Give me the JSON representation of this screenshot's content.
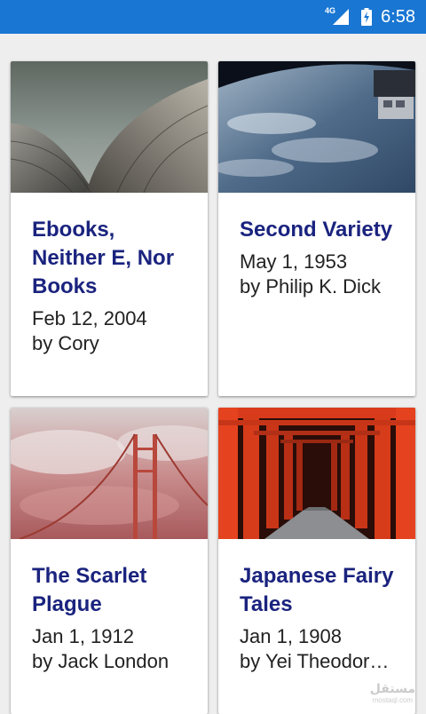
{
  "status_bar": {
    "network_type": "4G",
    "time": "6:58",
    "icons": [
      "signal-icon",
      "battery-charging-icon"
    ]
  },
  "books": [
    {
      "title": "Ebooks, Neither E, Nor Books",
      "date": "Feb 12, 2004",
      "author": "by Cory",
      "cover": "sydney-opera-house-roof-photo"
    },
    {
      "title": "Second Variety",
      "date": "May 1, 1953",
      "author": "by Philip K. Dick",
      "cover": "earth-from-space-station-photo"
    },
    {
      "title": "The Scarlet Plague",
      "date": "Jan 1, 1912",
      "author": "by Jack London",
      "cover": "golden-gate-bridge-fog-photo"
    },
    {
      "title": "Japanese Fairy Tales",
      "date": "Jan 1, 1908",
      "author": "by Yei Theodor…",
      "cover": "torii-gates-path-photo"
    }
  ],
  "colors": {
    "status_bar": "#1976d2",
    "title": "#1a237e",
    "background": "#eeeeee"
  },
  "watermark": {
    "text": "مستقل",
    "sub": "mostaql.com"
  }
}
